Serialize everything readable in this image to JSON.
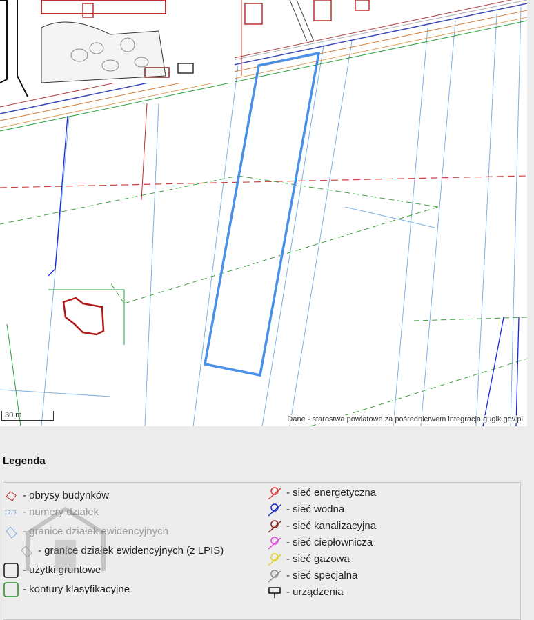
{
  "map": {
    "scale_label": "30 m",
    "attribution": "Dane - starostwa powiatowe za pośrednictwem integracja.gugik.gov.pl",
    "highlight_color": "#4a8fe8"
  },
  "legend": {
    "title": "Legenda",
    "left_items": [
      {
        "icon": "building-outline-icon",
        "label": "- obrysy budynków"
      },
      {
        "icon": "parcel-number-icon",
        "label": "- numery działek"
      },
      {
        "icon": "parcel-boundary-icon",
        "label": "- granice działek ewidencyjnych"
      },
      {
        "icon": "lpis-boundary-icon",
        "label": "- granice działek ewidencyjnych (z LPIS)"
      },
      {
        "icon": "land-use-icon",
        "label": "- użytki gruntowe"
      },
      {
        "icon": "classification-contour-icon",
        "label": "- kontury klasyfikacyjne"
      }
    ],
    "right_items": [
      {
        "icon": "power-network-icon",
        "label": "- sieć energetyczna",
        "color": "#e03030"
      },
      {
        "icon": "water-network-icon",
        "label": "- sieć wodna",
        "color": "#1a2ad8"
      },
      {
        "icon": "sewer-network-icon",
        "label": "- sieć kanalizacyjna",
        "color": "#8a2020"
      },
      {
        "icon": "heating-network-icon",
        "label": "- sieć ciepłownicza",
        "color": "#e040e0"
      },
      {
        "icon": "gas-network-icon",
        "label": "- sieć gazowa",
        "color": "#e0d020"
      },
      {
        "icon": "special-network-icon",
        "label": "- sieć specjalna",
        "color": "#888888"
      },
      {
        "icon": "device-icon",
        "label": "- urządzenia",
        "color": "#111111"
      }
    ]
  }
}
